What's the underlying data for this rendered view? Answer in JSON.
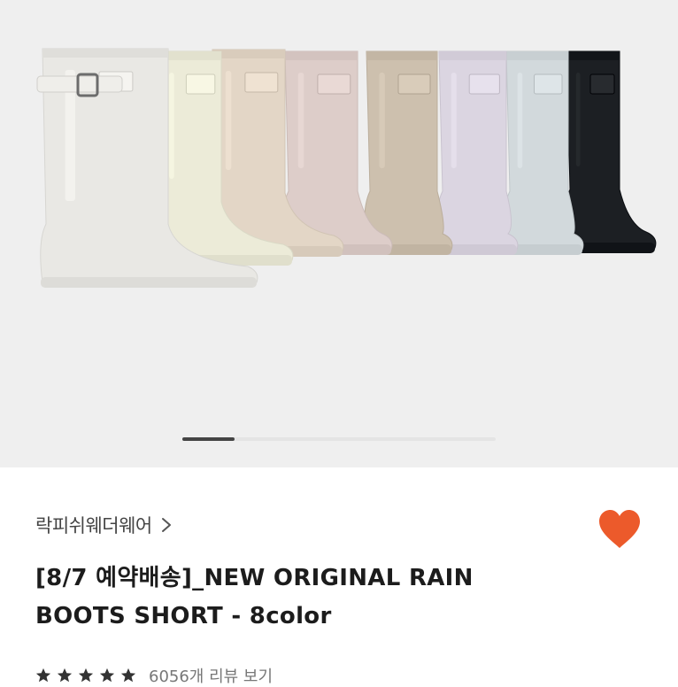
{
  "product_image": {
    "name": "rain-boots-8-colors-photo",
    "boot_colors": [
      "#e9e8e4",
      "#ecebd8",
      "#e3d6c6",
      "#ddcdc9",
      "#cdc0ae",
      "#dbd5e1",
      "#d2d9dc",
      "#1c1f23"
    ]
  },
  "carousel": {
    "current_page": 1
  },
  "brand": {
    "name": "락피쉬웨더웨어",
    "chevron_icon": "chevron-right-icon"
  },
  "wishlist": {
    "icon": "heart-icon",
    "active": true,
    "color": "#ec5a2b"
  },
  "product": {
    "title_line1": "[8/7 예약배송]_NEW ORIGINAL RAIN",
    "title_line2": "BOOTS SHORT - 8color"
  },
  "rating": {
    "stars": 5,
    "star_icon": "star-icon",
    "review_text": "6056개 리뷰 보기"
  }
}
